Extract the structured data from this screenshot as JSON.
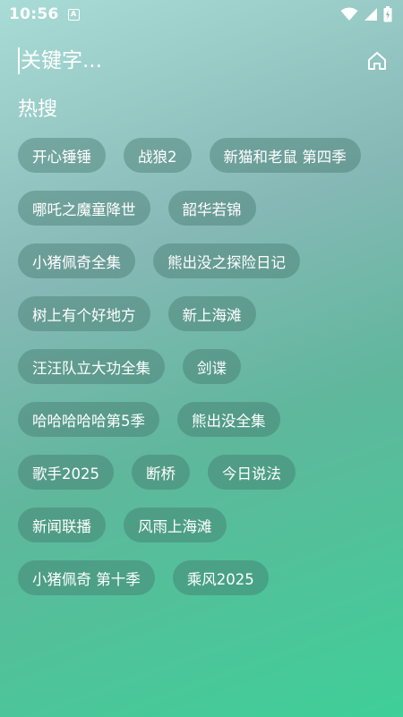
{
  "status": {
    "time": "10:56",
    "notification_icon": "A"
  },
  "search": {
    "placeholder": "关键字..."
  },
  "hot": {
    "title": "热搜",
    "rows": [
      [
        "开心锤锤",
        "战狼2",
        "新猫和老鼠 第四季"
      ],
      [
        "哪吒之魔童降世",
        "韶华若锦"
      ],
      [
        "小猪佩奇全集",
        "熊出没之探险日记"
      ],
      [
        "树上有个好地方",
        "新上海滩"
      ],
      [
        "汪汪队立大功全集",
        "剑谍"
      ],
      [
        "哈哈哈哈哈第5季",
        "熊出没全集"
      ],
      [
        "歌手2025",
        "断桥",
        "今日说法"
      ],
      [
        "新闻联播",
        "风雨上海滩"
      ],
      [
        "小猪佩奇 第十季",
        "乘风2025"
      ]
    ]
  },
  "icons": {
    "home": "home-icon",
    "wifi": "wifi-icon",
    "signal": "signal-icon",
    "battery": "battery-icon"
  }
}
